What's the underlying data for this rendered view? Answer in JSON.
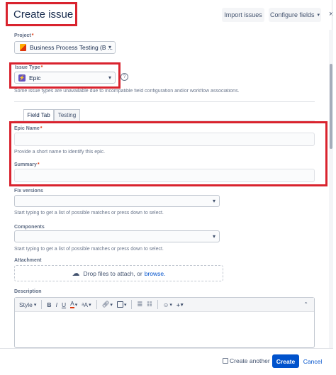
{
  "header": {
    "title": "Create issue",
    "import_label": "Import issues",
    "configure_label": "Configure fields"
  },
  "project": {
    "label": "Project",
    "value": "Business Process Testing (B ..."
  },
  "issue_type": {
    "label": "Issue Type",
    "value": "Epic",
    "note": "Some issue types are unavailable due to incompatible field configuration and/or workflow associations."
  },
  "tabs": [
    {
      "label": "Field Tab"
    },
    {
      "label": "Testing"
    }
  ],
  "epic_name": {
    "label": "Epic Name",
    "helper": "Provide a short name to identify this epic.",
    "value": ""
  },
  "summary": {
    "label": "Summary",
    "value": ""
  },
  "fix_versions": {
    "label": "Fix versions",
    "helper": "Start typing to get a list of possible matches or press down to select."
  },
  "components": {
    "label": "Components",
    "helper": "Start typing to get a list of possible matches or press down to select."
  },
  "attachment": {
    "label": "Attachment",
    "drop_text": "Drop files to attach, or",
    "browse_link": "browse."
  },
  "description": {
    "label": "Description",
    "toolbar": {
      "style_label": "Style",
      "bold": "B",
      "italic": "I",
      "underline": "U",
      "text_color": "A",
      "more_format": "ᵃA",
      "add": "+"
    }
  },
  "footer": {
    "create_another_label": "Create another",
    "create_label": "Create",
    "cancel_label": "Cancel"
  },
  "colors": {
    "primary": "#0052cc",
    "highlight": "#d9232e",
    "epic": "#6554c0"
  }
}
